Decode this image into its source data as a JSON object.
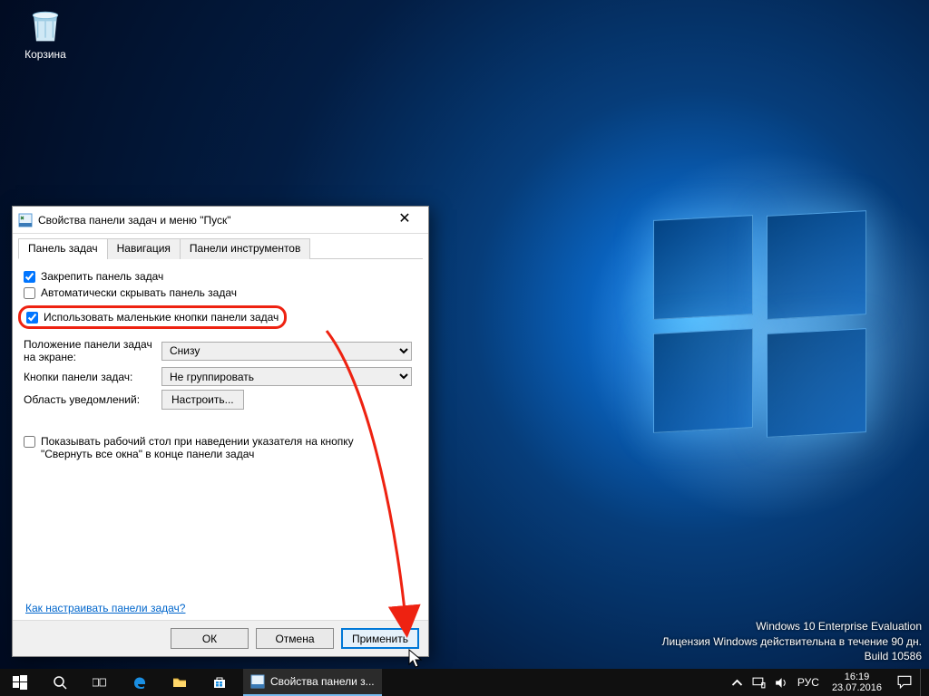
{
  "desktop": {
    "recycle_bin_label": "Корзина"
  },
  "watermark": {
    "line1": "Windows 10 Enterprise Evaluation",
    "line2": "Лицензия Windows действительна в течение 90 дн.",
    "line3": "Build 10586"
  },
  "dialog": {
    "title": "Свойства панели задач и меню \"Пуск\"",
    "tabs": {
      "taskbar": "Панель задач",
      "navigation": "Навигация",
      "toolbars": "Панели инструментов"
    },
    "lock_label": "Закрепить панель задач",
    "lock_checked": true,
    "autohide_label": "Автоматически скрывать панель задач",
    "autohide_checked": false,
    "small_buttons_label": "Использовать маленькие кнопки панели задач",
    "small_buttons_checked": true,
    "position_label": "Положение панели задач на экране:",
    "position_value": "Снизу",
    "buttons_label": "Кнопки панели задач:",
    "buttons_value": "Не группировать",
    "notif_area_label": "Область уведомлений:",
    "notif_customize": "Настроить...",
    "peek_label": "Показывать рабочий стол при наведении указателя на кнопку \"Свернуть все окна\" в конце панели задач",
    "peek_checked": false,
    "help_link": "Как настраивать панели задач?",
    "btn_ok": "ОК",
    "btn_cancel": "Отмена",
    "btn_apply": "Применить"
  },
  "taskbar": {
    "app_label": "Свойства панели з...",
    "lang": "РУС",
    "time": "16:19",
    "date": "23.07.2016"
  }
}
